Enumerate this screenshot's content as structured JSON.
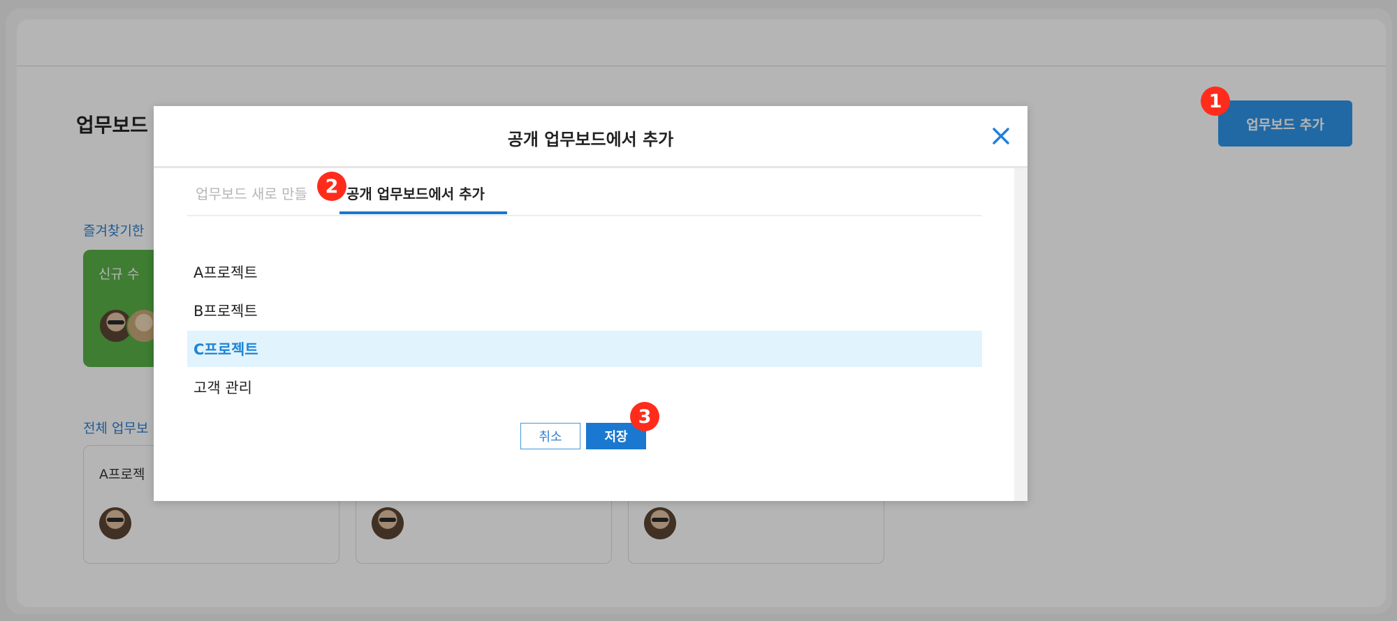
{
  "page": {
    "title": "업무보드",
    "add_board_label": "업무보드 추가",
    "favorites_label": "즐겨찾기한",
    "all_boards_label": "전체 업무보",
    "favorite_card_title": "신규 수",
    "board_cards": [
      {
        "title": "A프로젝"
      },
      {
        "title": ""
      },
      {
        "title": ""
      }
    ]
  },
  "modal": {
    "title": "공개 업무보드에서 추가",
    "close_icon": "close-icon",
    "tabs": [
      {
        "label": "업무보드 새로 만들"
      },
      {
        "label": "공개 업무보드에서 추가"
      }
    ],
    "items": [
      {
        "label": "A프로젝트",
        "selected": false
      },
      {
        "label": "B프로젝트",
        "selected": false
      },
      {
        "label": "C프로젝트",
        "selected": true
      },
      {
        "label": "고객 관리",
        "selected": false
      }
    ],
    "cancel_label": "취소",
    "save_label": "저장"
  },
  "markers": [
    "1",
    "2",
    "3"
  ],
  "colors": {
    "accent": "#1A78D0",
    "favorite_card": "#58B047",
    "selected_row": "#E1F3FD",
    "marker": "#FF2C1C"
  }
}
